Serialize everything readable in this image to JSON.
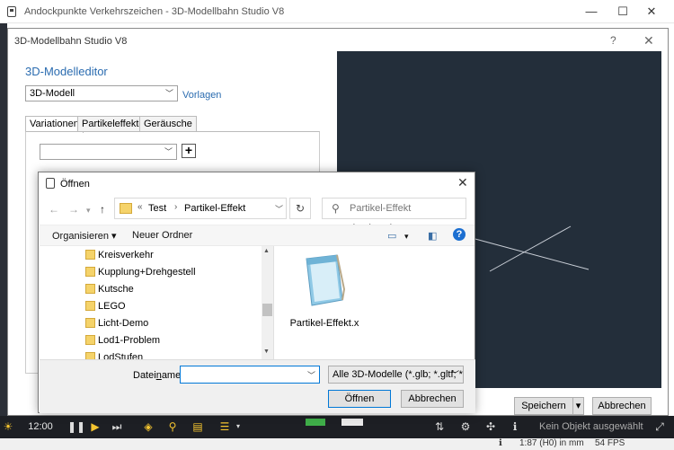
{
  "main_window": {
    "title": "Andockpunkte Verkehrszeichen - 3D-Modellbahn Studio V8",
    "minimize": "—",
    "maximize": "☐",
    "close": "✕"
  },
  "editor": {
    "title": "3D-Modellbahn Studio V8",
    "help": "?",
    "close": "✕",
    "heading": "3D-Modelleditor",
    "model_select": "3D-Modell",
    "templates_link": "Vorlagen",
    "tabs": [
      "Variationen",
      "Partikeleffekte",
      "Geräusche"
    ],
    "add_button": "+",
    "save_button": "Speichern",
    "cancel_button": "Abbrechen"
  },
  "toolbar": {
    "time": "12:00",
    "status_text": "Kein Objekt ausgewählt"
  },
  "statusbar": {
    "info_icon": "ℹ",
    "scale": "1:87 (H0) in mm",
    "fps": "54 FPS"
  },
  "open_dialog": {
    "title": "Öffnen",
    "breadcrumb_prefix": "«",
    "breadcrumb": [
      "Test",
      "Partikel-Effekt"
    ],
    "search_placeholder": "Partikel-Effekt durchsuchen",
    "organize": "Organisieren",
    "new_folder": "Neuer Ordner",
    "folders": [
      "Kreisverkehr",
      "Kupplung+Drehgestell",
      "Kutsche",
      "LEGO",
      "Licht-Demo",
      "Lod1-Problem",
      "LodStufen"
    ],
    "file_name": "Partikel-Effekt.x",
    "filename_label_pre": "Datei",
    "filename_label_under": "n",
    "filename_label_post": "ame:",
    "filename_value": "",
    "filetype": "Alle 3D-Modelle (*.glb; *.gltf; *.",
    "open_button": "Öffnen",
    "cancel_button": "Abbrechen"
  },
  "colors": {
    "accent": "#2b6cb0",
    "viewport": "#232e3a",
    "toolbar": "#1d1f24",
    "green_button": "#3fae49"
  }
}
